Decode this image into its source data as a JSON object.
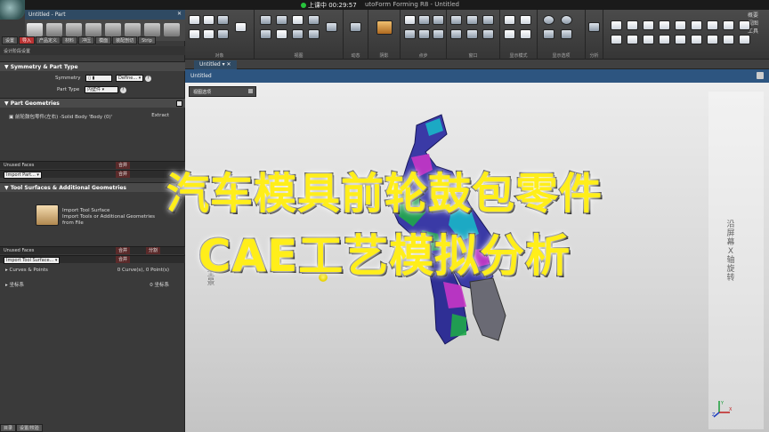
{
  "window": {
    "title": "utoForm Forming R8 - Untitled",
    "recording": "上课中 00:29:57",
    "panel_title": "Untitled - Part"
  },
  "ribbon": {
    "tabs": [
      "概要",
      "视图",
      "工具"
    ],
    "groups": [
      "对象",
      "视图",
      "动态",
      "阴影",
      "点步",
      "窗口",
      "显示模式",
      "显示选项",
      "分析"
    ]
  },
  "left_panel": {
    "process_tabs": [
      "设置",
      "导入",
      "产品定义",
      "材料",
      "冲压",
      "模面",
      "装配剖切",
      "Strip"
    ],
    "stages_label": "设计阶段设置",
    "symmetry": {
      "heading": "Symmetry & Part Type",
      "symmetry_label": "Symmetry",
      "symmetry_value": "Define...",
      "part_type_label": "Part Type",
      "part_type_value": "内壁件"
    },
    "part_geometries": {
      "heading": "Part Geometries",
      "item": "前轮鼓包零件(左右) -Solid Body 'Body (0)'",
      "extract_label": "Extract"
    },
    "unused_faces_1": {
      "label": "Unused Faces",
      "btn": "合并"
    },
    "import_part": {
      "label": "Import Part...",
      "btn": "合并"
    },
    "tool_surfaces": {
      "heading": "Tool Surfaces & Additional Geometries",
      "button_title": "Import Tool Surface",
      "button_desc_1": "Import Tools or Additional Geometries",
      "button_desc_2": "from File"
    },
    "unused_faces_2": {
      "label": "Unused Faces",
      "btn": "合并",
      "btn2": "分割"
    },
    "import_tool": {
      "label": "Import Tool Surface...",
      "btn": "合并"
    },
    "curves": {
      "label": "Curves & Points",
      "value": "0 Curve(s), 0 Point(s)"
    },
    "coords": {
      "label": "坐标系",
      "value": "0 坐标系"
    },
    "bottom_tabs": [
      "目录",
      "设置/校验"
    ]
  },
  "viewport": {
    "tab": "Untitled",
    "title": "Untitled",
    "view_menu": "视图选项",
    "right_text": "沿屏幕X轴旋转",
    "left_text": "全景",
    "axis_x": "X",
    "axis_y": "Y",
    "axis_z": "Z"
  },
  "overlay": {
    "line1": "汽车模具前轮鼓包零件",
    "line2": "CAE工艺模拟分析"
  }
}
